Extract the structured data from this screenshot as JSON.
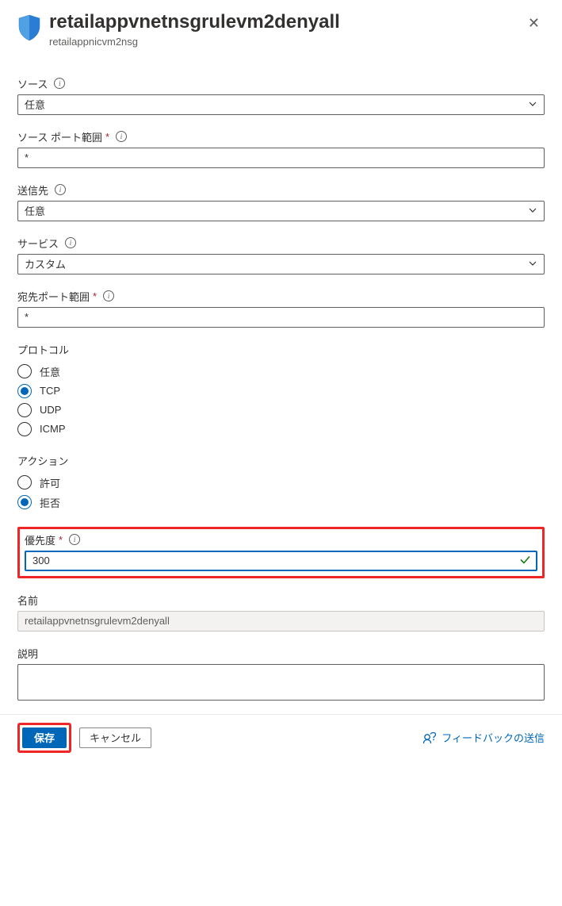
{
  "header": {
    "title": "retailappvnetnsgrulevm2denyall",
    "subtitle": "retailappnicvm2nsg"
  },
  "fields": {
    "source": {
      "label": "ソース",
      "value": "任意"
    },
    "sourcePort": {
      "label": "ソース ポート範囲",
      "value": "*"
    },
    "destination": {
      "label": "送信先",
      "value": "任意"
    },
    "service": {
      "label": "サービス",
      "value": "カスタム"
    },
    "destPort": {
      "label": "宛先ポート範囲",
      "value": "*"
    },
    "protocol": {
      "label": "プロトコル",
      "options": [
        "任意",
        "TCP",
        "UDP",
        "ICMP"
      ],
      "selected": "TCP"
    },
    "action": {
      "label": "アクション",
      "options": [
        "許可",
        "拒否"
      ],
      "selected": "拒否"
    },
    "priority": {
      "label": "優先度",
      "value": "300"
    },
    "name": {
      "label": "名前",
      "value": "retailappvnetnsgrulevm2denyall"
    },
    "description": {
      "label": "説明",
      "value": ""
    }
  },
  "footer": {
    "save": "保存",
    "cancel": "キャンセル",
    "feedback": "フィードバックの送信"
  }
}
